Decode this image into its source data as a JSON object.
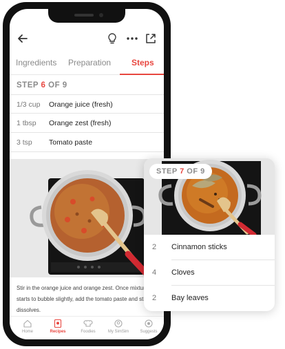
{
  "tabs": [
    {
      "label": "Ingredients"
    },
    {
      "label": "Preparation"
    },
    {
      "label": "Steps"
    }
  ],
  "step": {
    "prefix": "STEP",
    "current": "6",
    "suffix": "OF 9"
  },
  "ingredients": [
    {
      "qty": "1/3 cup",
      "name": "Orange juice (fresh)"
    },
    {
      "qty": "1 tbsp",
      "name": "Orange zest (fresh)"
    },
    {
      "qty": "3 tsp",
      "name": "Tomato paste"
    }
  ],
  "instruction": "Stir in the orange juice and orange zest. Once mixture starts to bubble slightly, add the tomato paste and stir until it dissolves.",
  "nav": [
    {
      "label": "Home",
      "icon": "home-icon"
    },
    {
      "label": "Recipes",
      "icon": "recipes-icon"
    },
    {
      "label": "Foodies",
      "icon": "chef-hat-icon"
    },
    {
      "label": "My SimSim",
      "icon": "simsim-icon"
    },
    {
      "label": "Suggests",
      "icon": "suggests-icon"
    }
  ],
  "next_step": {
    "step": {
      "prefix": "STEP",
      "current": "7",
      "suffix": "OF 9"
    },
    "ingredients": [
      {
        "qty": "2",
        "name": "Cinnamon sticks"
      },
      {
        "qty": "4",
        "name": "Cloves"
      },
      {
        "qty": "2",
        "name": "Bay leaves"
      }
    ]
  },
  "colors": {
    "accent": "#e8463f",
    "text": "#222222",
    "muted": "#8a8a8a"
  }
}
